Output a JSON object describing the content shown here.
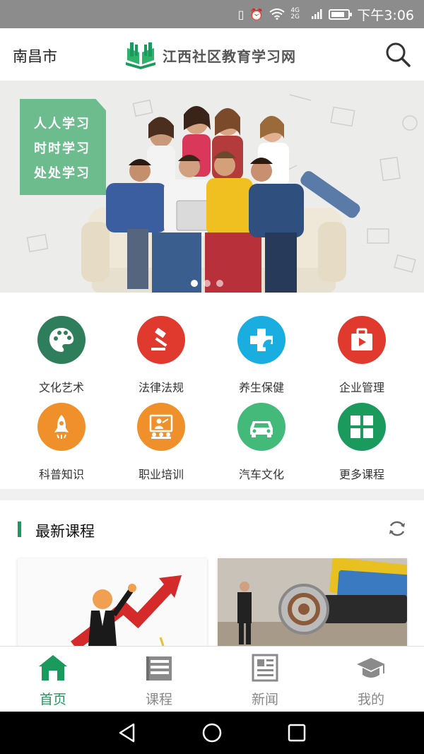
{
  "status_bar": {
    "network": "4G 2G",
    "time": "下午3:06"
  },
  "header": {
    "city": "南昌市",
    "site_name": "江西社区教育学习网"
  },
  "banner": {
    "slogans": [
      "人人学习",
      "时时学习",
      "处处学习"
    ],
    "slides": 3,
    "active_slide": 1
  },
  "categories": [
    {
      "label": "文化艺术",
      "icon": "palette-icon",
      "color": "#2e7d5b"
    },
    {
      "label": "法律法规",
      "icon": "gavel-icon",
      "color": "#e03a2e"
    },
    {
      "label": "养生保健",
      "icon": "health-cross-icon",
      "color": "#1aaee0"
    },
    {
      "label": "企业管理",
      "icon": "briefcase-icon",
      "color": "#e03a2e"
    },
    {
      "label": "科普知识",
      "icon": "rocket-icon",
      "color": "#f0902a"
    },
    {
      "label": "职业培训",
      "icon": "training-icon",
      "color": "#f0902a"
    },
    {
      "label": "汽车文化",
      "icon": "car-icon",
      "color": "#43b97a"
    },
    {
      "label": "更多课程",
      "icon": "grid-icon",
      "color": "#1a9a5c"
    }
  ],
  "latest": {
    "title": "最新课程"
  },
  "tabs": [
    {
      "label": "首页",
      "icon": "home-icon",
      "active": true
    },
    {
      "label": "课程",
      "icon": "courses-icon",
      "active": false
    },
    {
      "label": "新闻",
      "icon": "news-icon",
      "active": false
    },
    {
      "label": "我的",
      "icon": "profile-icon",
      "active": false
    }
  ],
  "colors": {
    "accent": "#1a9a5c",
    "status_bar": "#8c8c8c"
  }
}
